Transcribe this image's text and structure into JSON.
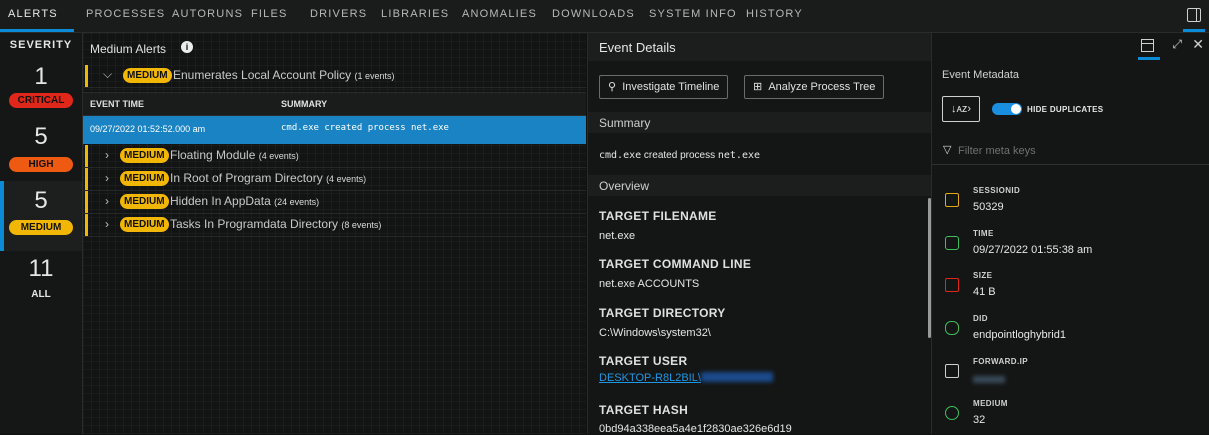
{
  "nav": {
    "tabs": [
      "ALERTS",
      "PROCESSES",
      "AUTORUNS",
      "FILES",
      "DRIVERS",
      "LIBRARIES",
      "ANOMALIES",
      "DOWNLOADS",
      "SYSTEM INFO",
      "HISTORY"
    ],
    "active_tab": "ALERTS",
    "accent_color": "#0b8bd6"
  },
  "severity": {
    "header": "SEVERITY",
    "levels": [
      {
        "count": "1",
        "label": "CRITICAL",
        "color": "#e0271a"
      },
      {
        "count": "5",
        "label": "HIGH",
        "color": "#ee5a12"
      },
      {
        "count": "5",
        "label": "MEDIUM",
        "color": "#f2b705"
      },
      {
        "count": "11",
        "label": "ALL",
        "color": ""
      }
    ],
    "active": "MEDIUM"
  },
  "alerts": {
    "title": "Medium Alerts",
    "groups": [
      {
        "severity": "MEDIUM",
        "name": "Enumerates Local Account Policy",
        "events": "(1 events)",
        "expanded": true
      },
      {
        "severity": "MEDIUM",
        "name": "Floating Module",
        "events": "(4 events)",
        "expanded": false
      },
      {
        "severity": "MEDIUM",
        "name": "In Root of Program Directory",
        "events": "(4 events)",
        "expanded": false
      },
      {
        "severity": "MEDIUM",
        "name": "Hidden In AppData",
        "events": "(24 events)",
        "expanded": false
      },
      {
        "severity": "MEDIUM",
        "name": "Tasks In Programdata Directory",
        "events": "(8 events)",
        "expanded": false
      }
    ],
    "table": {
      "columns": [
        "EVENT TIME",
        "SUMMARY"
      ],
      "rows": [
        {
          "time": "09/27/2022 01:52:52.000 am",
          "summary": "cmd.exe created process net.exe"
        }
      ]
    }
  },
  "details": {
    "title": "Event Details",
    "buttons": {
      "timeline": "Investigate Timeline",
      "process_tree": "Analyze Process Tree"
    },
    "summary_header": "Summary",
    "summary": {
      "proc1": "cmd.exe",
      "mid": " created process ",
      "proc2": "net.exe"
    },
    "overview_header": "Overview",
    "fields": [
      {
        "label": "TARGET FILENAME",
        "value": "net.exe"
      },
      {
        "label": "TARGET COMMAND LINE",
        "value": "net.exe ACCOUNTS"
      },
      {
        "label": "TARGET DIRECTORY",
        "value": "C:\\Windows\\system32\\"
      },
      {
        "label": "TARGET USER",
        "value": "DESKTOP-R8L2BIL\\"
      },
      {
        "label": "TARGET HASH",
        "value": "0bd94a338eea5a4e1f2830ae326e6d19"
      }
    ]
  },
  "metadata": {
    "title": "Event Metadata",
    "sort_label": "↓ᴀᴢ›",
    "hide_duplicates_label": "HIDE DUPLICATES",
    "hide_duplicates_on": true,
    "filter_placeholder": "Filter meta keys",
    "items": [
      {
        "key": "SESSIONID",
        "value": "50329",
        "icon": "session-icon",
        "color": "#e6a817"
      },
      {
        "key": "TIME",
        "value": "09/27/2022 01:55:38 am",
        "icon": "clock-icon",
        "color": "#3fbf5a"
      },
      {
        "key": "SIZE",
        "value": "41 B",
        "icon": "size-icon",
        "color": "#e0271a"
      },
      {
        "key": "DID",
        "value": "endpointloghybrid1",
        "icon": "database-icon",
        "color": "#3fbf5a"
      },
      {
        "key": "FORWARD.IP",
        "value": "",
        "icon": "ip-icon",
        "color": "#cfcfcf"
      },
      {
        "key": "MEDIUM",
        "value": "32",
        "icon": "medium-icon",
        "color": "#3fbf5a"
      }
    ]
  }
}
